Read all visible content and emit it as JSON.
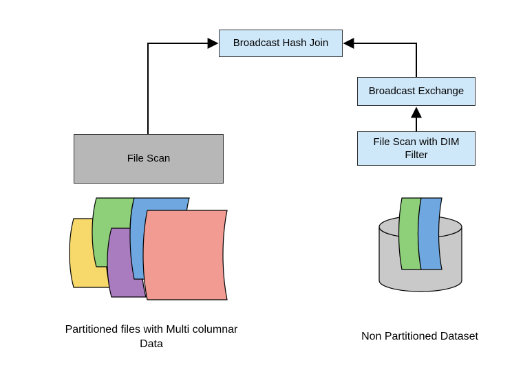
{
  "nodes": {
    "broadcast_hash_join": "Broadcast Hash Join",
    "broadcast_exchange": "Broadcast Exchange",
    "file_scan_dim": "File Scan with DIM Filter",
    "file_scan": "File Scan"
  },
  "captions": {
    "left": "Partitioned files with Multi columnar Data",
    "right": "Non Partitioned Dataset"
  }
}
